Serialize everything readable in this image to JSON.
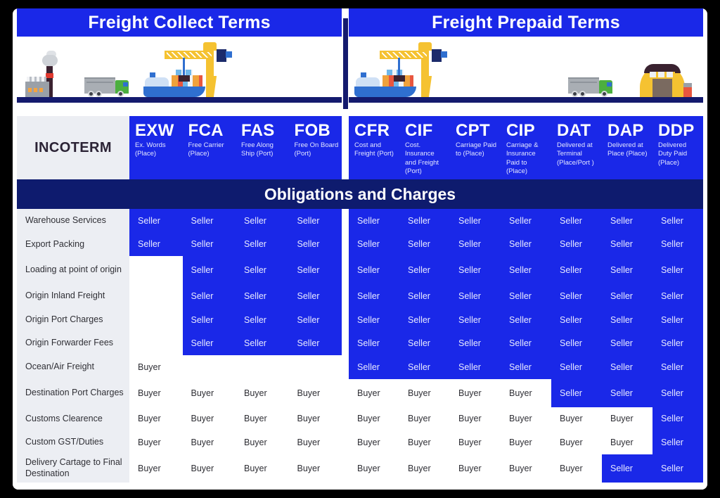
{
  "banners": {
    "left": "Freight Collect Terms",
    "right": "Freight Prepaid Terms"
  },
  "incoterm_label": "INCOTERM",
  "obligations_title": "Obligations and Charges",
  "colors": {
    "brand_blue": "#1a28e8",
    "navy": "#0e1b6e",
    "label_grey": "#eceef3",
    "frame_black": "#000000",
    "crane_yellow": "#f5c231"
  },
  "terms_left": [
    {
      "code": "EXW",
      "desc": "Ex. Words (Place)"
    },
    {
      "code": "FCA",
      "desc": "Free Carrier (Place)"
    },
    {
      "code": "FAS",
      "desc": "Free Along Ship (Port)"
    },
    {
      "code": "FOB",
      "desc": "Free On Board (Port)"
    }
  ],
  "terms_right": [
    {
      "code": "CFR",
      "desc": "Cost and Freight (Port)"
    },
    {
      "code": "CIF",
      "desc": "Cost. Insurance and Freight (Port)"
    },
    {
      "code": "CPT",
      "desc": "Carriage Paid to (Place)"
    },
    {
      "code": "CIP",
      "desc": "Carriage & Insurance Paid to (Place)"
    },
    {
      "code": "DAT",
      "desc": "Delivered at Terminal (Place/Port )"
    },
    {
      "code": "DAP",
      "desc": "Delivered at Place (Place)"
    },
    {
      "code": "DDP",
      "desc": "Delivered Duty Paid (Place)"
    }
  ],
  "value_labels": {
    "seller": "Seller",
    "buyer": "Buyer",
    "blank": ""
  },
  "rows": [
    {
      "label": "Warehouse Services",
      "left": [
        "Seller",
        "Seller",
        "Seller",
        "Seller"
      ],
      "right": [
        "Seller",
        "Seller",
        "Seller",
        "Seller",
        "Seller",
        "Seller",
        "Seller"
      ]
    },
    {
      "label": "Export Packing",
      "left": [
        "Seller",
        "Seller",
        "Seller",
        "Seller"
      ],
      "right": [
        "Seller",
        "Seller",
        "Seller",
        "Seller",
        "Seller",
        "Seller",
        "Seller"
      ]
    },
    {
      "label": "Loading at point of origin",
      "left": [
        "",
        "Seller",
        "Seller",
        "Seller"
      ],
      "right": [
        "Seller",
        "Seller",
        "Seller",
        "Seller",
        "Seller",
        "Seller",
        "Seller"
      ]
    },
    {
      "label": "Origin Inland Freight",
      "left": [
        "",
        "Seller",
        "Seller",
        "Seller"
      ],
      "right": [
        "Seller",
        "Seller",
        "Seller",
        "Seller",
        "Seller",
        "Seller",
        "Seller"
      ]
    },
    {
      "label": "Origin Port Charges",
      "left": [
        "",
        "Seller",
        "Seller",
        "Seller"
      ],
      "right": [
        "Seller",
        "Seller",
        "Seller",
        "Seller",
        "Seller",
        "Seller",
        "Seller"
      ]
    },
    {
      "label": "Origin Forwarder Fees",
      "left": [
        "",
        "Seller",
        "Seller",
        "Seller"
      ],
      "right": [
        "Seller",
        "Seller",
        "Seller",
        "Seller",
        "Seller",
        "Seller",
        "Seller"
      ]
    },
    {
      "label": "Ocean/Air Freight",
      "left": [
        "Buyer",
        "",
        "",
        ""
      ],
      "right": [
        "Seller",
        "Seller",
        "Seller",
        "Seller",
        "Seller",
        "Seller",
        "Seller"
      ]
    },
    {
      "label": "Destination Port Charges",
      "left": [
        "Buyer",
        "Buyer",
        "Buyer",
        "Buyer"
      ],
      "right": [
        "Buyer",
        "Buyer",
        "Buyer",
        "Buyer",
        "Seller",
        "Seller",
        "Seller"
      ]
    },
    {
      "label": "Customs Clearence",
      "left": [
        "Buyer",
        "Buyer",
        "Buyer",
        "Buyer"
      ],
      "right": [
        "Buyer",
        "Buyer",
        "Buyer",
        "Buyer",
        "Buyer",
        "Buyer",
        "Seller"
      ]
    },
    {
      "label": "Custom GST/Duties",
      "left": [
        "Buyer",
        "Buyer",
        "Buyer",
        "Buyer"
      ],
      "right": [
        "Buyer",
        "Buyer",
        "Buyer",
        "Buyer",
        "Buyer",
        "Buyer",
        "Seller"
      ]
    },
    {
      "label": "Delivery Cartage to Final Destination",
      "left": [
        "Buyer",
        "Buyer",
        "Buyer",
        "Buyer"
      ],
      "right": [
        "Buyer",
        "Buyer",
        "Buyer",
        "Buyer",
        "Buyer",
        "Seller",
        "Seller"
      ]
    }
  ],
  "illustrations": {
    "left": [
      "factory-icon",
      "truck-icon",
      "ship-icon",
      "crane-icon"
    ],
    "right": [
      "ship-icon",
      "crane-icon",
      "truck-icon",
      "warehouse-icon"
    ]
  }
}
